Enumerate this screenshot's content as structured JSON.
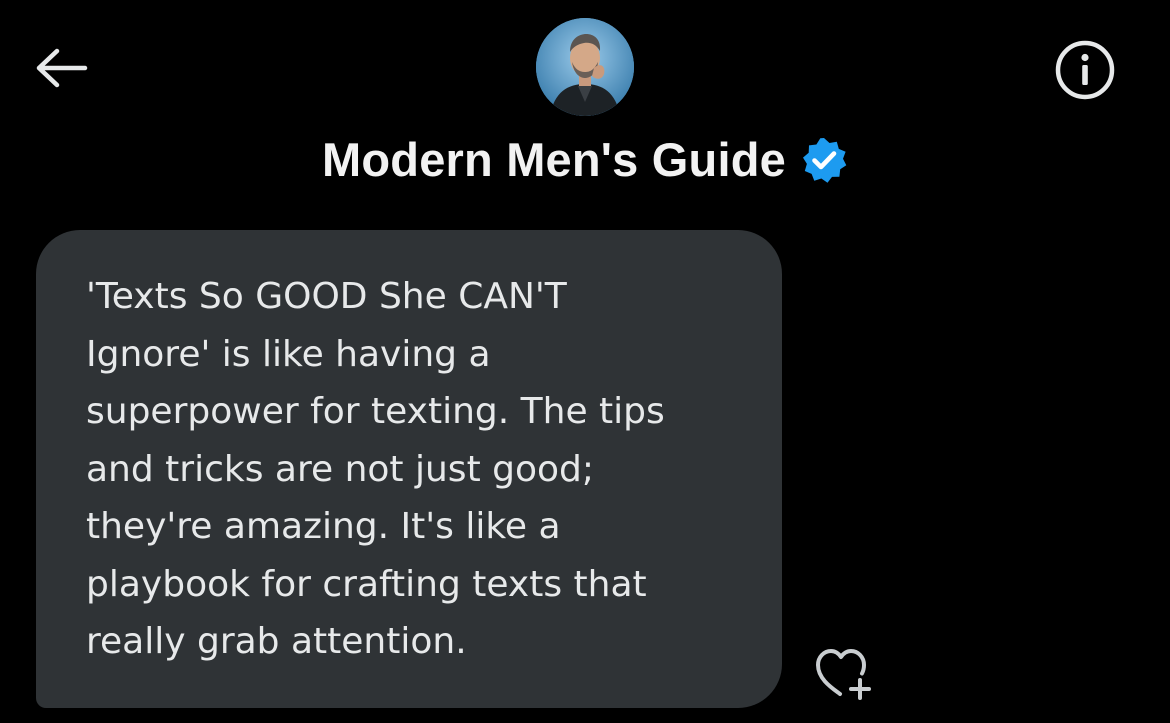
{
  "header": {
    "back_icon": "arrow-left-icon",
    "info_icon": "info-circle-icon",
    "contact_name": "Modern Men's Guide",
    "verified_icon": "verified-badge-icon",
    "verified_color": "#1d9bf0"
  },
  "message": {
    "text": "'Texts So GOOD She CAN'T\nIgnore' is like having a\nsuperpower for texting. The tips\nand tricks are not just good;\nthey're amazing. It's like a\nplaybook for crafting texts that\nreally grab attention.",
    "bubble_color": "#2f3336",
    "react_icon": "heart-plus-icon"
  },
  "theme": {
    "background": "#000000",
    "text_color": "#e7e9ea"
  }
}
